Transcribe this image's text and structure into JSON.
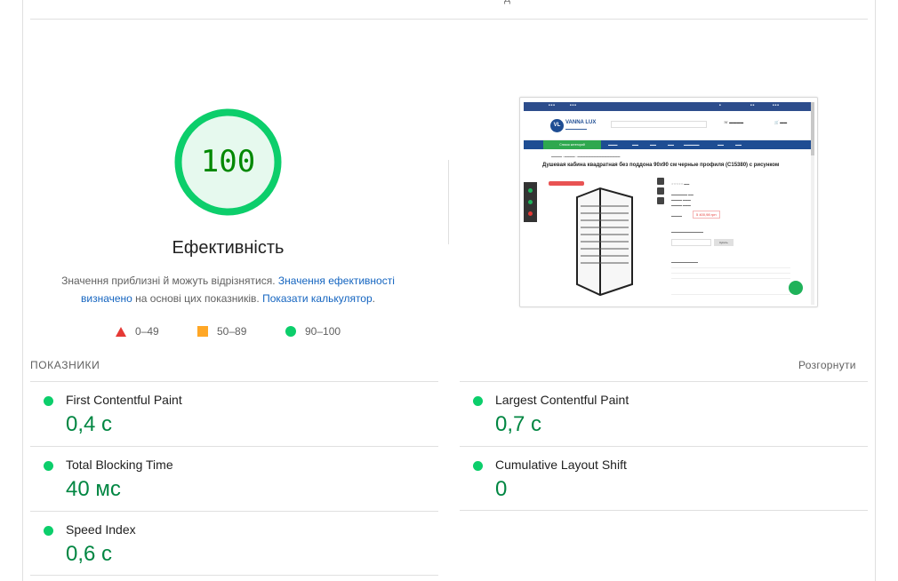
{
  "header": {
    "clipped_text": "д"
  },
  "score": {
    "value": "100",
    "title": "Ефективність",
    "ring_color": "#0cce6b",
    "fill_color": "#e6f9ee",
    "text_color": "#008800",
    "fraction": 1.0
  },
  "description": {
    "text_1": "Значення приблизні й можуть відрізнятися. ",
    "link_1": "Значення ефективності визначено",
    "text_2": " на основі цих показників. ",
    "link_2": "Показати калькулятор",
    "text_3": "."
  },
  "legend": [
    {
      "label": "0–49",
      "shape": "triangle",
      "color": "#e53935"
    },
    {
      "label": "50–89",
      "shape": "square",
      "color": "#ffa726"
    },
    {
      "label": "90–100",
      "shape": "circle",
      "color": "#0cce6b"
    }
  ],
  "screenshot": {
    "logo_initials": "VL",
    "logo_name": "VANNA LUX",
    "product_title": "Душевая кабина квадратная без поддона 90x90 см черные профиля (С15380) с рисунком",
    "category_button": "Список категорий",
    "price": "5 400,98 грн",
    "buy_button": "Купить"
  },
  "metrics_section": {
    "title": "ПОКАЗНИКИ",
    "expand_label": "Розгорнути"
  },
  "metrics": [
    {
      "name": "First Contentful Paint",
      "value": "0,4 с",
      "status_color": "#0cce6b"
    },
    {
      "name": "Largest Contentful Paint",
      "value": "0,7 с",
      "status_color": "#0cce6b"
    },
    {
      "name": "Total Blocking Time",
      "value": "40 мс",
      "status_color": "#0cce6b"
    },
    {
      "name": "Cumulative Layout Shift",
      "value": "0",
      "status_color": "#0cce6b"
    },
    {
      "name": "Speed Index",
      "value": "0,6 с",
      "status_color": "#0cce6b"
    }
  ]
}
